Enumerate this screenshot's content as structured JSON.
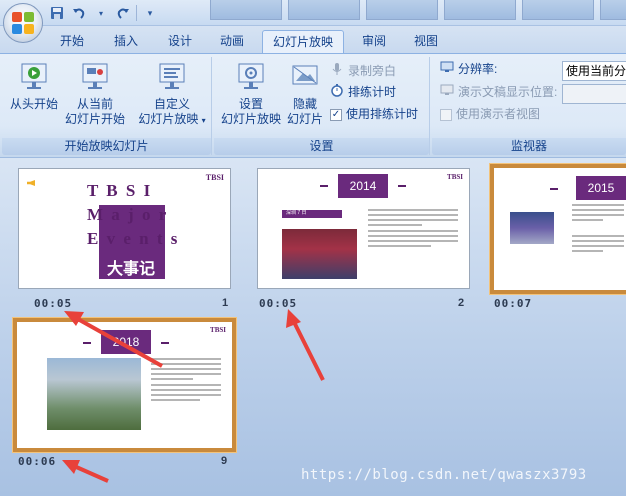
{
  "quick_access": {
    "save_icon": "save-icon",
    "undo_icon": "undo-icon",
    "redo_icon": "redo-icon",
    "customize_icon": "customize-qat-icon"
  },
  "tabs": [
    {
      "label": "开始",
      "active": false
    },
    {
      "label": "插入",
      "active": false
    },
    {
      "label": "设计",
      "active": false
    },
    {
      "label": "动画",
      "active": false
    },
    {
      "label": "幻灯片放映",
      "active": true
    },
    {
      "label": "审阅",
      "active": false
    },
    {
      "label": "视图",
      "active": false
    }
  ],
  "groups": {
    "start_slideshow": {
      "label": "开始放映幻灯片",
      "from_beginning": "从头开始",
      "from_current_1": "从当前",
      "from_current_2": "幻灯片开始",
      "custom_1": "自定义",
      "custom_2": "幻灯片放映"
    },
    "setup": {
      "label": "设置",
      "setup_1": "设置",
      "setup_2": "幻灯片放映",
      "hide_1": "隐藏",
      "hide_2": "幻灯片",
      "record_narration": "录制旁白",
      "rehearse_timings": "排练计时",
      "use_rehearsed_timings": "使用排练计时",
      "use_rehearsed_checked": true
    },
    "monitors": {
      "label": "监视器",
      "resolution_label": "分辨率:",
      "resolution_value": "使用当前分",
      "show_on_label": "演示文稿显示位置:",
      "show_on_value": "",
      "presenter_view": "使用演示者视图"
    }
  },
  "slides": [
    {
      "num": "1",
      "time": "00:05",
      "title_letters": [
        "T B S I",
        "M a j o r",
        "E v e n t s"
      ],
      "subtitle": "大事记",
      "logo": "TBSI"
    },
    {
      "num": "2",
      "time": "00:05",
      "year": "2014",
      "logo": "TBSI",
      "tag": "深圳 7 日"
    },
    {
      "num": "",
      "time": "00:07",
      "year": "2015"
    },
    {
      "num": "9",
      "time": "00:06",
      "year": "2018",
      "logo": "TBSI"
    }
  ],
  "watermark": "https://blog.csdn.net/qwaszx3793",
  "colors": {
    "accent": "#6a2a7d",
    "ribbon_text": "#15428b",
    "arrow": "#e8413a",
    "selection": "#c98a3c"
  }
}
